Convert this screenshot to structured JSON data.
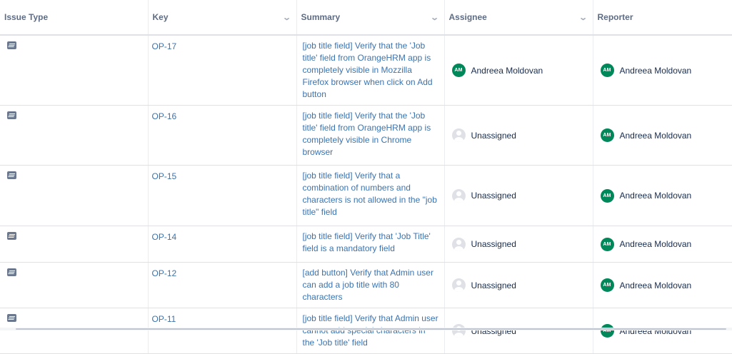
{
  "columns": [
    "Issue Type",
    "Key",
    "Summary",
    "Assignee",
    "Reporter"
  ],
  "rows": [
    {
      "type_icon": "task-icon",
      "key": "OP-17",
      "summary": "[job title field] Verify that the 'Job title' field from OrangeHRM app is completely visible in Mozzilla Firefox browser when click on Add button",
      "assignee": {
        "name": "Andreea Moldovan",
        "initials": "AM"
      },
      "reporter": {
        "name": "Andreea Moldovan",
        "initials": "AM"
      }
    },
    {
      "type_icon": "task-icon",
      "key": "OP-16",
      "summary": "[job title field] Verify that the 'Job title' field from OrangeHRM app is completely visible in Chrome browser",
      "assignee": {
        "name": "Unassigned",
        "initials": ""
      },
      "reporter": {
        "name": "Andreea Moldovan",
        "initials": "AM"
      }
    },
    {
      "type_icon": "task-icon",
      "key": "OP-15",
      "summary": "[job title field] Verify that a combination of numbers and characters is not allowed in the \"job title\" field",
      "assignee": {
        "name": "Unassigned",
        "initials": ""
      },
      "reporter": {
        "name": "Andreea Moldovan",
        "initials": "AM"
      }
    },
    {
      "type_icon": "task-icon",
      "key": "OP-14",
      "summary": "[job title field] Verify that 'Job Title' field is a mandatory field",
      "assignee": {
        "name": "Unassigned",
        "initials": ""
      },
      "reporter": {
        "name": "Andreea Moldovan",
        "initials": "AM"
      }
    },
    {
      "type_icon": "task-icon",
      "key": "OP-12",
      "summary": "[add button] Verify that Admin user can add a job title with 80 characters",
      "assignee": {
        "name": "Unassigned",
        "initials": ""
      },
      "reporter": {
        "name": "Andreea Moldovan",
        "initials": "AM"
      }
    },
    {
      "type_icon": "task-icon",
      "key": "OP-11",
      "summary": "[job title field] Verify that Admin user cannot add special characters in the 'Job title' field",
      "assignee": {
        "name": "Unassigned",
        "initials": ""
      },
      "reporter": {
        "name": "Andreea Moldovan",
        "initials": "AM"
      }
    }
  ],
  "colors": {
    "link": "#3b73af",
    "avatar": "#00875a",
    "header_text": "#5e6c84"
  }
}
